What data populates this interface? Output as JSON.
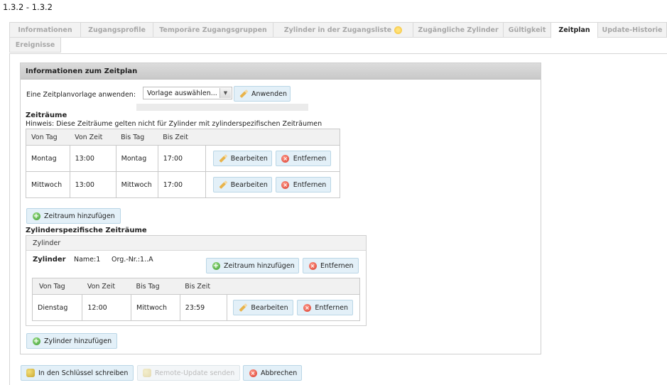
{
  "page": {
    "title": "1.3.2 - 1.3.2"
  },
  "tabs": [
    {
      "label": "Informationen",
      "active": false
    },
    {
      "label": "Zugangsprofile",
      "active": false
    },
    {
      "label": "Temporäre Zugangsgruppen",
      "active": false
    },
    {
      "label": "Zylinder in der Zugangsliste",
      "active": false,
      "icon": "sun-icon"
    },
    {
      "label": "Zugängliche Zylinder",
      "active": false
    },
    {
      "label": "Gültigkeit",
      "active": false
    },
    {
      "label": "Zeitplan",
      "active": true
    },
    {
      "label": "Update-Historie",
      "active": false
    },
    {
      "label": "Ereignisse",
      "active": false
    }
  ],
  "panel": {
    "header": "Informationen zum Zeitplan",
    "template_label": "Eine Zeitplanvorlage anwenden:",
    "template_select": "Vorlage auswählen...",
    "apply_button": "Anwenden",
    "timeframes_title": "Zeiträume",
    "timeframes_hint": "Hinweis: Diese Zeiträume gelten nicht für Zylinder mit zylinderspezifischen Zeiträumen",
    "columns": [
      "Von Tag",
      "Von Zeit",
      "Bis Tag",
      "Bis Zeit"
    ],
    "rows": [
      {
        "from_day": "Montag",
        "from_time": "13:00",
        "to_day": "Montag",
        "to_time": "17:00"
      },
      {
        "from_day": "Mittwoch",
        "from_time": "13:00",
        "to_day": "Mittwoch",
        "to_time": "17:00"
      }
    ],
    "edit_button": "Bearbeiten",
    "remove_button": "Entfernen",
    "add_timeframe_button": "Zeitraum hinzufügen",
    "cyl_title": "Zylinderspezifische Zeiträume",
    "cyl_header": "Zylinder",
    "cyl_label": "Zylinder",
    "cyl_name": "Name:1",
    "cyl_org": "Org.-Nr.:1..A",
    "cyl_add_timeframe": "Zeitraum hinzufügen",
    "cyl_remove": "Entfernen",
    "cyl_rows": [
      {
        "from_day": "Dienstag",
        "from_time": "12:00",
        "to_day": "Mittwoch",
        "to_time": "23:59"
      }
    ],
    "add_cylinder_button": "Zylinder hinzufügen"
  },
  "footer": {
    "write_key": "In den Schlüssel schreiben",
    "remote_update": "Remote-Update senden",
    "cancel": "Abbrechen"
  }
}
